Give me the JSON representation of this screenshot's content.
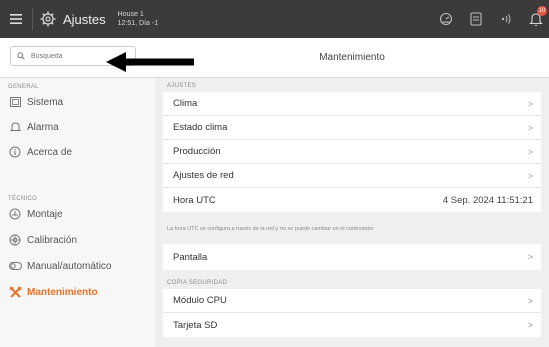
{
  "topbar": {
    "app_title": "Ajustes",
    "house_name": "House 1",
    "house_time": "12:51, Día -1",
    "notification_count": "10",
    "badge_color": "#e5533d",
    "icons": [
      "menu-icon",
      "gear-icon",
      "dashboard-icon",
      "document-icon",
      "signal-icon",
      "bell-icon"
    ]
  },
  "search": {
    "placeholder": "Búsqueda"
  },
  "header": {
    "section_title": "Mantenimiento"
  },
  "sidebar": {
    "groups": [
      {
        "label": "GENERAL",
        "items": [
          {
            "label": "Sistema",
            "icon": "system-icon"
          },
          {
            "label": "Alarma",
            "icon": "alarm-bell-icon"
          },
          {
            "label": "Acerca de",
            "icon": "info-icon"
          }
        ]
      },
      {
        "label": "TÉCNICO",
        "items": [
          {
            "label": "Montaje",
            "icon": "mount-icon"
          },
          {
            "label": "Calibración",
            "icon": "calibration-icon"
          },
          {
            "label": "Manual/automático",
            "icon": "toggle-icon"
          },
          {
            "label": "Mantenimiento",
            "icon": "tools-icon",
            "active": true
          }
        ]
      }
    ],
    "active_color": "#e8732a"
  },
  "main": {
    "ajustes_label": "AJUSTES",
    "ajustes_rows": [
      {
        "label": "Clima"
      },
      {
        "label": "Estado clima"
      },
      {
        "label": "Producción"
      },
      {
        "label": "Ajustes de red"
      }
    ],
    "utc_row": {
      "label": "Hora UTC",
      "value": "4 Sep. 2024 11:51:21"
    },
    "utc_note": "La hora UTC se configura a través de la red y no se puede cambiar en el controlador",
    "pantalla_row": {
      "label": "Pantalla"
    },
    "backup_label": "COPIA SEGURIDAD",
    "backup_rows": [
      {
        "label": "Módulo CPU"
      },
      {
        "label": "Tarjeta SD"
      }
    ],
    "chevron": ">"
  }
}
